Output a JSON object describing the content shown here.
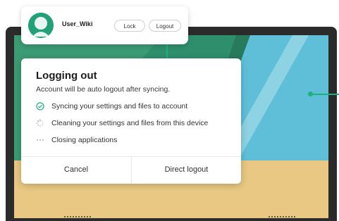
{
  "user_popup": {
    "username": "User_Wiki",
    "lock_label": "Lock",
    "logout_label": "Logout",
    "avatar_icon": "user-avatar-icon"
  },
  "dialog": {
    "title": "Logging out",
    "subtitle": "Account will be auto logout after syncing.",
    "steps": [
      {
        "label": "Syncing your settings and files to account",
        "status": "done",
        "icon": "check-circle-icon"
      },
      {
        "label": "Cleaning your settings and files from this device",
        "status": "in-progress",
        "icon": "spinner-icon"
      },
      {
        "label": "Closing applications",
        "status": "pending",
        "icon": "ellipsis-icon"
      }
    ],
    "cancel_label": "Cancel",
    "direct_logout_label": "Direct logout"
  },
  "colors": {
    "accent": "#1fb07f",
    "wallpaper_green": "#2e8f6c",
    "wallpaper_blue": "#5fbfd8",
    "wallpaper_sand": "#e8c882",
    "monitor_frame": "#2b2b2b"
  }
}
